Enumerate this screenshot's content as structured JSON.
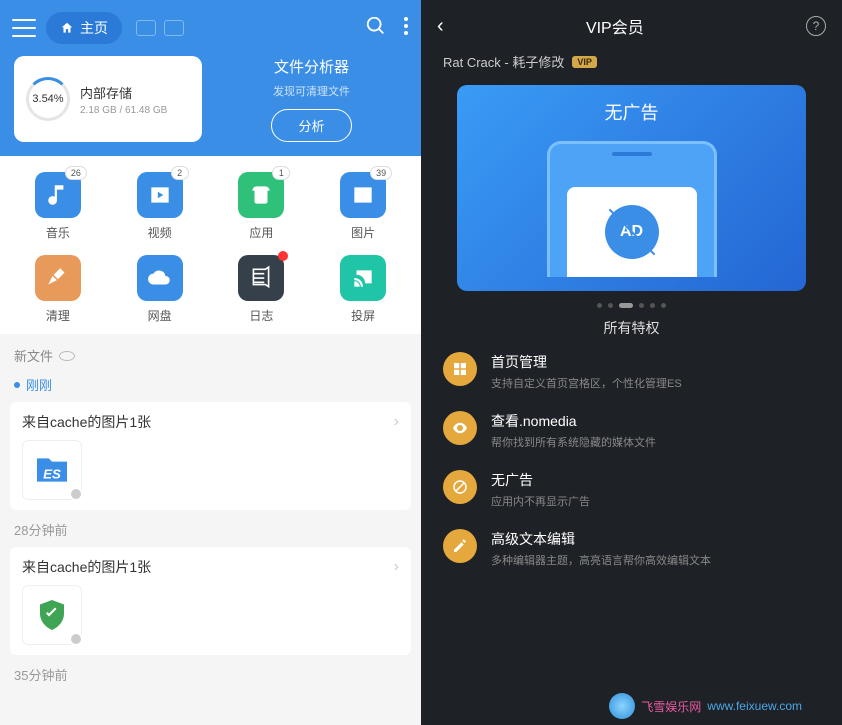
{
  "left": {
    "home_label": "主页",
    "storage": {
      "pct": "3.54%",
      "title": "内部存储",
      "sub": "2.18 GB / 61.48 GB"
    },
    "analyzer": {
      "title": "文件分析器",
      "sub": "发现可清理文件",
      "btn": "分析"
    },
    "grid": [
      {
        "label": "音乐",
        "color": "#3a8ee6",
        "badge": "26",
        "icon": "music"
      },
      {
        "label": "视频",
        "color": "#3a8ee6",
        "badge": "2",
        "icon": "video"
      },
      {
        "label": "应用",
        "color": "#2fc17a",
        "badge": "1",
        "icon": "android"
      },
      {
        "label": "图片",
        "color": "#3a8ee6",
        "badge": "39",
        "icon": "image"
      },
      {
        "label": "清理",
        "color": "#e89a5a",
        "badge": null,
        "icon": "broom"
      },
      {
        "label": "网盘",
        "color": "#3a8ee6",
        "badge": null,
        "icon": "cloud"
      },
      {
        "label": "日志",
        "color": "#36404a",
        "badge": null,
        "icon": "log",
        "reddot": true
      },
      {
        "label": "投屏",
        "color": "#20c5a8",
        "badge": null,
        "icon": "cast"
      }
    ],
    "new_files_label": "新文件",
    "timeline": [
      {
        "time": "刚刚",
        "blue": true,
        "card_title": "来自cache的图片1张",
        "thumb": "es"
      },
      {
        "time": "28分钟前",
        "blue": false,
        "card_title": "来自cache的图片1张",
        "thumb": "shield"
      },
      {
        "time": "35分钟前",
        "blue": false,
        "card_title": null
      }
    ]
  },
  "right": {
    "title": "VIP会员",
    "user": "Rat Crack - 耗子修改",
    "vip_tag": "VIP",
    "banner_heading": "无广告",
    "banner_ad_text": "AD",
    "all_privileges": "所有特权",
    "privileges": [
      {
        "title": "首页管理",
        "sub": "支持自定义首页宫格区，个性化管理ES",
        "icon": "grid"
      },
      {
        "title": "查看.nomedia",
        "sub": "帮你找到所有系统隐藏的媒体文件",
        "icon": "eye"
      },
      {
        "title": "无广告",
        "sub": "应用内不再显示广告",
        "icon": "noad"
      },
      {
        "title": "高级文本编辑",
        "sub": "多种编辑器主题，高亮语言帮你高效编辑文本",
        "icon": "edit"
      }
    ]
  },
  "footer_wm": "www.feixuew.com"
}
